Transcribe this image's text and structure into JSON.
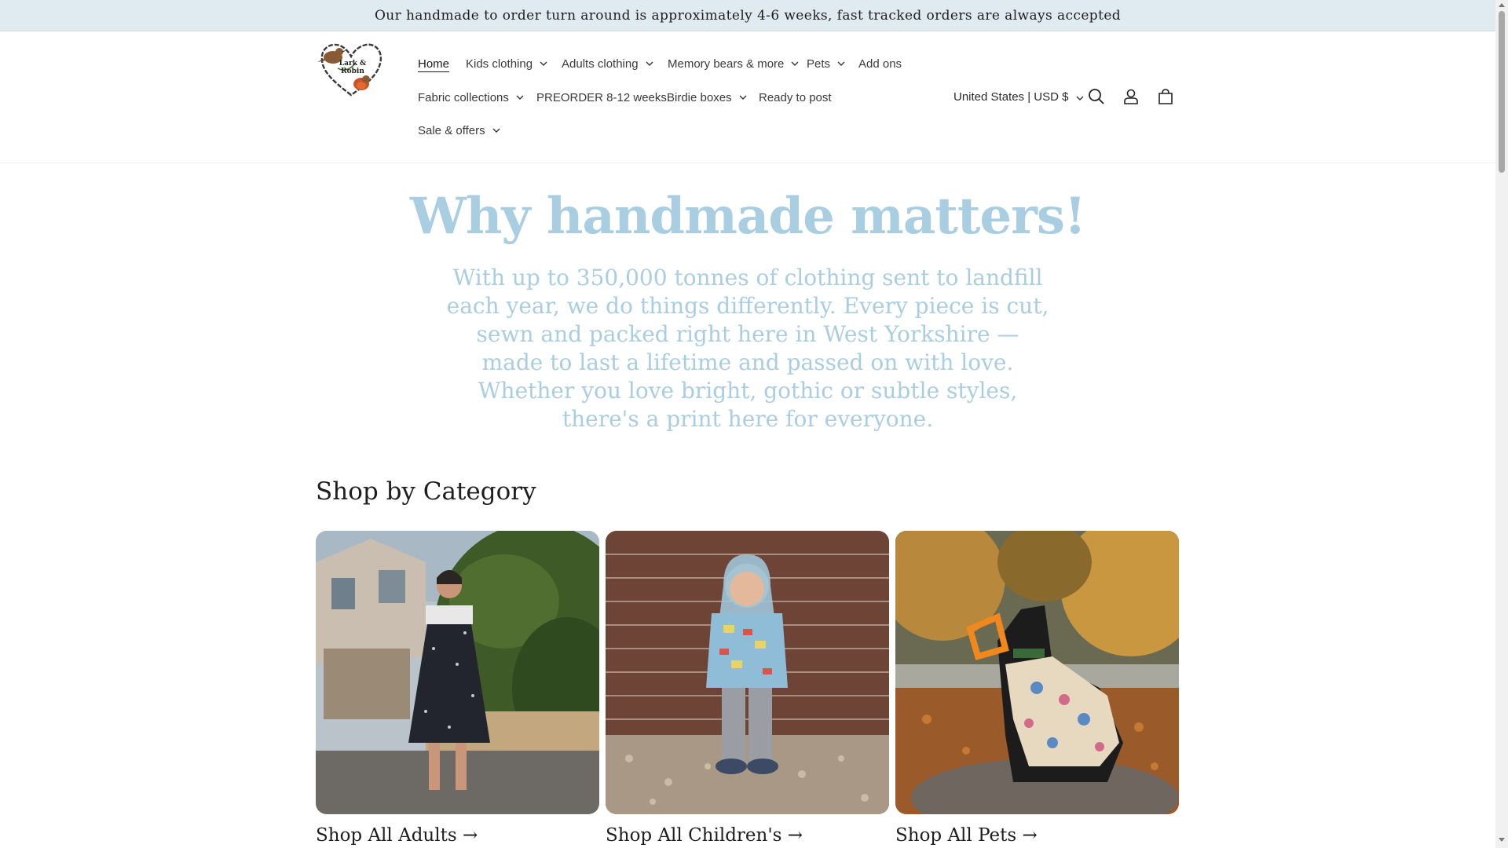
{
  "announcement": "Our handmade to order turn around is approximately 4-6 weeks, fast tracked orders are always accepted",
  "logo": {
    "text_line1": "Lark &",
    "text_line2": "Robin"
  },
  "nav": {
    "home": "Home",
    "kids": "Kids clothing",
    "adults": "Adults clothing",
    "memory": "Memory bears & more",
    "pets": "Pets",
    "addons": "Add ons",
    "fabric": "Fabric collections",
    "preorder": "PREORDER 8-12 weeks",
    "birdie": "Birdie boxes",
    "ready": "Ready to post",
    "sale": "Sale & offers"
  },
  "header": {
    "country": "United States | USD $"
  },
  "hero": {
    "title": "Why handmade matters!",
    "text": "With up to 350,000 tonnes of clothing sent to landfill each year, we do things differently. Every piece is cut, sewn and packed right here in West Yorkshire — made to last a lifetime and passed on with love. Whether you love bright, gothic or subtle styles, there's a print here for everyone."
  },
  "categories": {
    "title": "Shop by Category",
    "items": [
      {
        "label": "Shop All Adults →"
      },
      {
        "label": "Shop All Children's →"
      },
      {
        "label": "Shop All Pets →"
      }
    ]
  },
  "colors": {
    "hero_blue": "#a9cde1",
    "announce_bg": "#dfeaf1"
  }
}
